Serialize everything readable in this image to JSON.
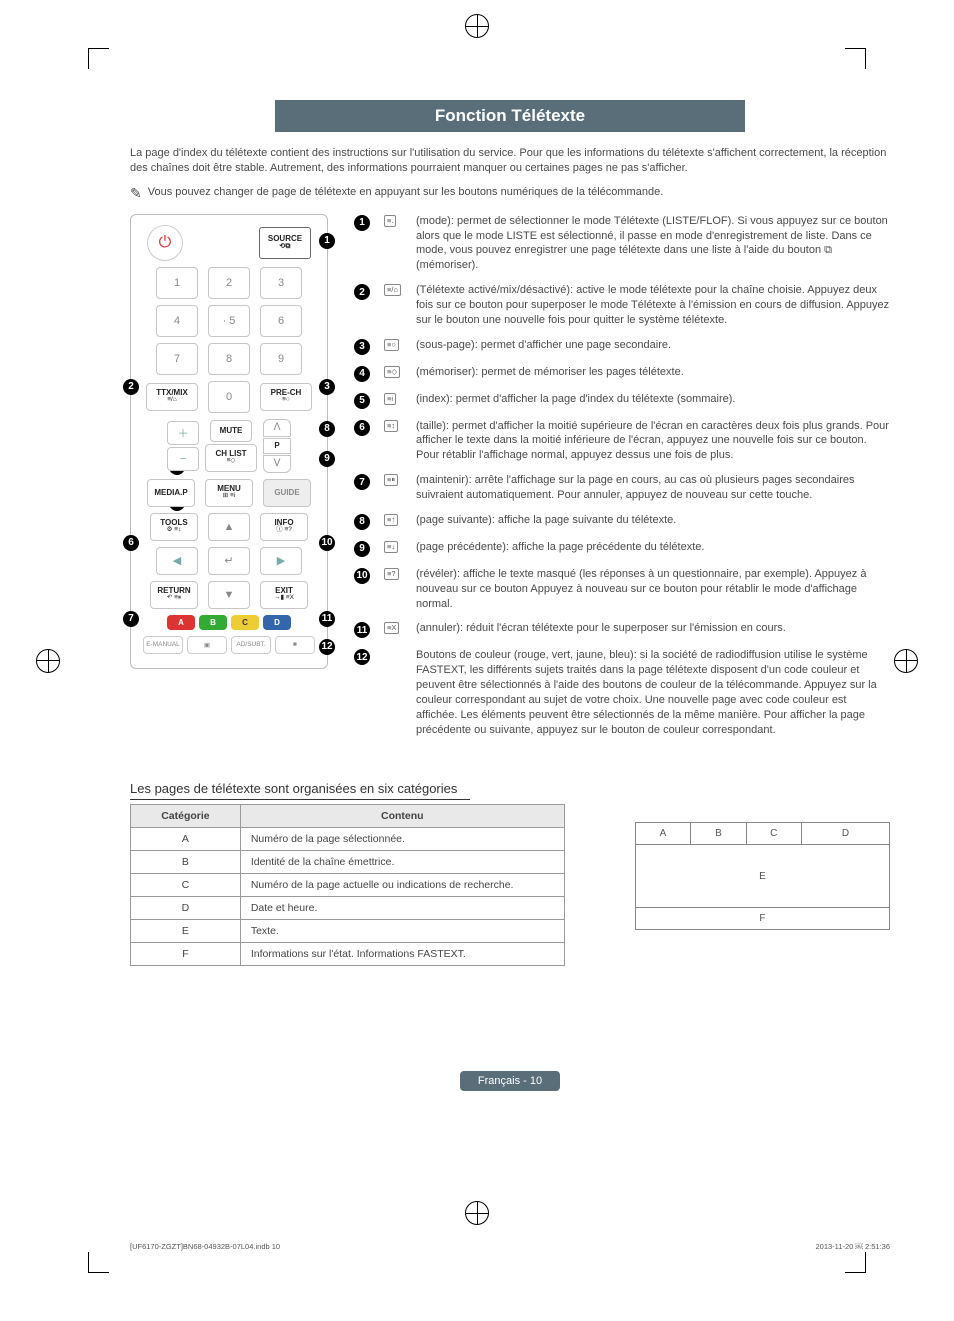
{
  "header": {
    "title": "Fonction Télétexte"
  },
  "intro": "La page d'index du télétexte contient des instructions sur l'utilisation du service. Pour que les informations du télétexte s'affichent correctement, la réception des chaînes doit être stable. Autrement, des informations pourraient manquer ou certaines pages ne pas s'afficher.",
  "note": "Vous pouvez changer de page de télétexte en appuyant sur les boutons numériques de la télécommande.",
  "remote": {
    "source": "SOURCE",
    "ttx": "TTX/MIX",
    "prech": "PRE-CH",
    "mute": "MUTE",
    "chlist": "CH LIST",
    "media": "MEDIA.P",
    "menu": "MENU",
    "guide": "GUIDE",
    "tools": "TOOLS",
    "info": "INFO",
    "return": "RETURN",
    "exit": "EXIT",
    "emanual": "E-MANUAL",
    "adsubt": "AD/SUBT.",
    "letters": {
      "a": "A",
      "b": "B",
      "c": "C",
      "d": "D"
    }
  },
  "items": [
    {
      "n": "1",
      "icon": "≡.",
      "text": "(mode): permet de sélectionner le mode Télétexte (LISTE/FLOF). Si vous appuyez sur ce bouton alors que le mode LISTE est sélectionné, il passe en mode d'enregistrement de liste. Dans ce mode, vous pouvez enregistrer une page télétexte dans une liste à l'aide du bouton ⧉ (mémoriser)."
    },
    {
      "n": "2",
      "icon": "≡/⌂",
      "text": "(Télétexte activé/mix/désactivé): active le mode télétexte pour la chaîne choisie. Appuyez deux fois sur ce bouton pour superposer le mode Télétexte à l'émission en cours de diffusion. Appuyez sur le bouton une nouvelle fois pour quitter le système télétexte."
    },
    {
      "n": "3",
      "icon": "≡○",
      "text": "(sous-page): permet d'afficher une page secondaire."
    },
    {
      "n": "4",
      "icon": "≡◇",
      "text": "(mémoriser): permet de mémoriser les pages télétexte."
    },
    {
      "n": "5",
      "icon": "≡i",
      "text": "(index): permet d'afficher la page d'index du télétexte (sommaire)."
    },
    {
      "n": "6",
      "icon": "≡↕",
      "text": "(taille): permet d'afficher la moitié supérieure de l'écran en caractères deux fois plus grands. Pour afficher le texte dans la moitié inférieure de l'écran, appuyez une nouvelle fois sur ce bouton. Pour rétablir l'affichage normal, appuyez dessus une fois de plus."
    },
    {
      "n": "7",
      "icon": "≡⏸",
      "text": "(maintenir): arrête l'affichage sur la page en cours, au cas où plusieurs pages secondaires suivraient automatiquement. Pour annuler, appuyez de nouveau sur cette touche."
    },
    {
      "n": "8",
      "icon": "≡↑",
      "text": "(page suivante): affiche la page suivante du télétexte."
    },
    {
      "n": "9",
      "icon": "≡↓",
      "text": "(page précédente): affiche la page précédente du télétexte."
    },
    {
      "n": "10",
      "icon": "≡?",
      "text": "(révéler): affiche le texte masqué (les réponses à un questionnaire, par exemple). Appuyez à nouveau sur ce bouton Appuyez à nouveau sur ce bouton pour rétablir le mode d'affichage normal."
    },
    {
      "n": "11",
      "icon": "≡X",
      "text": "(annuler): réduit l'écran télétexte pour le superposer sur l'émission en cours."
    },
    {
      "n": "12",
      "icon": "",
      "text": "Boutons de couleur (rouge, vert, jaune, bleu): si la société de radiodiffusion utilise le système FASTEXT, les différents sujets traités dans la page télétexte disposent d'un code couleur et peuvent être sélectionnés à l'aide des boutons de couleur de la télécommande. Appuyez sur la couleur correspondant au sujet de votre choix. Une nouvelle page avec code couleur est affichée. Les éléments peuvent être sélectionnés de la même manière. Pour afficher la page précédente ou suivante, appuyez sur le bouton de couleur correspondant."
    }
  ],
  "section_title": "Les pages de télétexte sont organisées en six catégories",
  "table": {
    "headers": {
      "cat": "Catégorie",
      "content": "Contenu"
    },
    "rows": [
      {
        "cat": "A",
        "content": "Numéro de la page sélectionnée."
      },
      {
        "cat": "B",
        "content": "Identité de la chaîne émettrice."
      },
      {
        "cat": "C",
        "content": "Numéro de la page actuelle ou indications de recherche."
      },
      {
        "cat": "D",
        "content": "Date et heure."
      },
      {
        "cat": "E",
        "content": "Texte."
      },
      {
        "cat": "F",
        "content": "Informations sur l'état. Informations FASTEXT."
      }
    ]
  },
  "layout": {
    "a": "A",
    "b": "B",
    "c": "C",
    "d": "D",
    "e": "E",
    "f": "F"
  },
  "footer": {
    "page_label": "Français - 10",
    "doc_ref": "[UF6170-ZGZT]BN68-04932B-07L04.indb   10",
    "timestamp": "2013-11-20   ￼ 2:51:36"
  }
}
